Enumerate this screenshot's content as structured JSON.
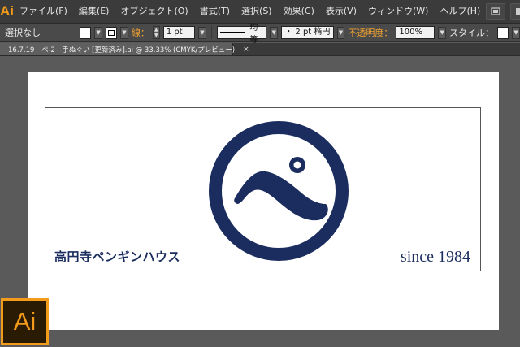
{
  "app": {
    "logo_text": "Ai",
    "accent": "#f39b1b",
    "brand_navy": "#1a2d5e"
  },
  "menu": [
    "ファイル(F)",
    "編集(E)",
    "オブジェクト(O)",
    "書式(T)",
    "選択(S)",
    "効果(C)",
    "表示(V)",
    "ウィンドウ(W)",
    "ヘルプ(H)"
  ],
  "menubar_icons": [
    "bridge-icon",
    "workspace-switcher-icon"
  ],
  "controlbar": {
    "selection_status": "選択なし",
    "stroke_label": "線：",
    "stroke_weight": "1 pt",
    "stroke_profile": "均等",
    "brush_label": "・ 2 pt 楕円",
    "opacity_label": "不透明度：",
    "opacity_value": "100%",
    "style_label": "スタイル："
  },
  "document_tab": {
    "label": "16.7.19　ペ-2　手ぬぐい [更新済み].ai @ 33.33% (CMYK/プレビュー)",
    "close": "×"
  },
  "artwork": {
    "logo_glyph": "ペ",
    "company_name": "高円寺ペンギンハウス",
    "since": "since 1984"
  },
  "badge": {
    "text": "Ai"
  }
}
